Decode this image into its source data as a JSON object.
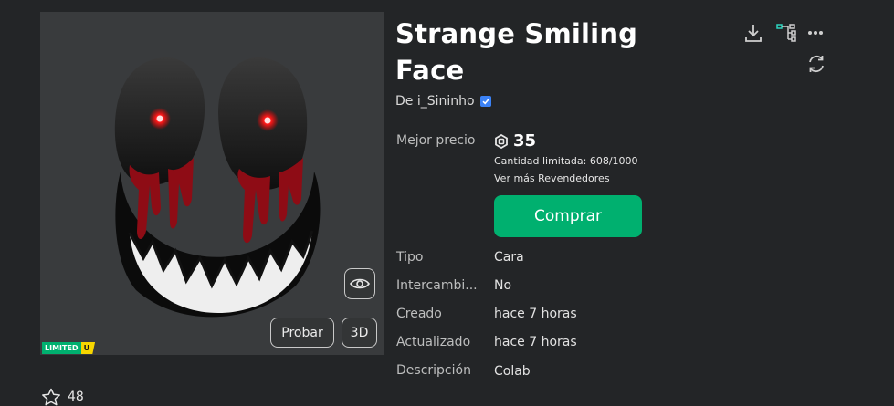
{
  "item": {
    "title": "Strange Smiling Face",
    "creator": "De i_Sininho",
    "best_price_label": "Mejor precio",
    "price": "35",
    "quantity_text": "Cantidad limitada: 608/1000",
    "more_resellers": "Ver más Revendedores",
    "buy_label": "Comprar"
  },
  "thumbnail": {
    "try_label": "Probar",
    "btn_3d_label": "3D",
    "badge_limited": "LIMITED",
    "badge_u": "U"
  },
  "details": [
    {
      "label": "Tipo",
      "value": "Cara"
    },
    {
      "label": "Intercambi...",
      "value": "No"
    },
    {
      "label": "Creado",
      "value": "hace 7 horas"
    },
    {
      "label": "Actualizado",
      "value": "hace 7 horas"
    },
    {
      "label": "Descripción",
      "value": "Colab"
    }
  ],
  "favorites": {
    "count": "48"
  },
  "icons": [
    "download-icon",
    "hierarchy-icon",
    "more-icon",
    "refresh-icon",
    "eye-icon",
    "robux-icon",
    "verified-icon",
    "star-icon"
  ],
  "colors": {
    "accent_green": "#00b06f",
    "background": "#232527",
    "thumbnail_bg": "#393b3d",
    "limited_yellow": "#f7d600",
    "verified_blue": "#3b82f6"
  }
}
